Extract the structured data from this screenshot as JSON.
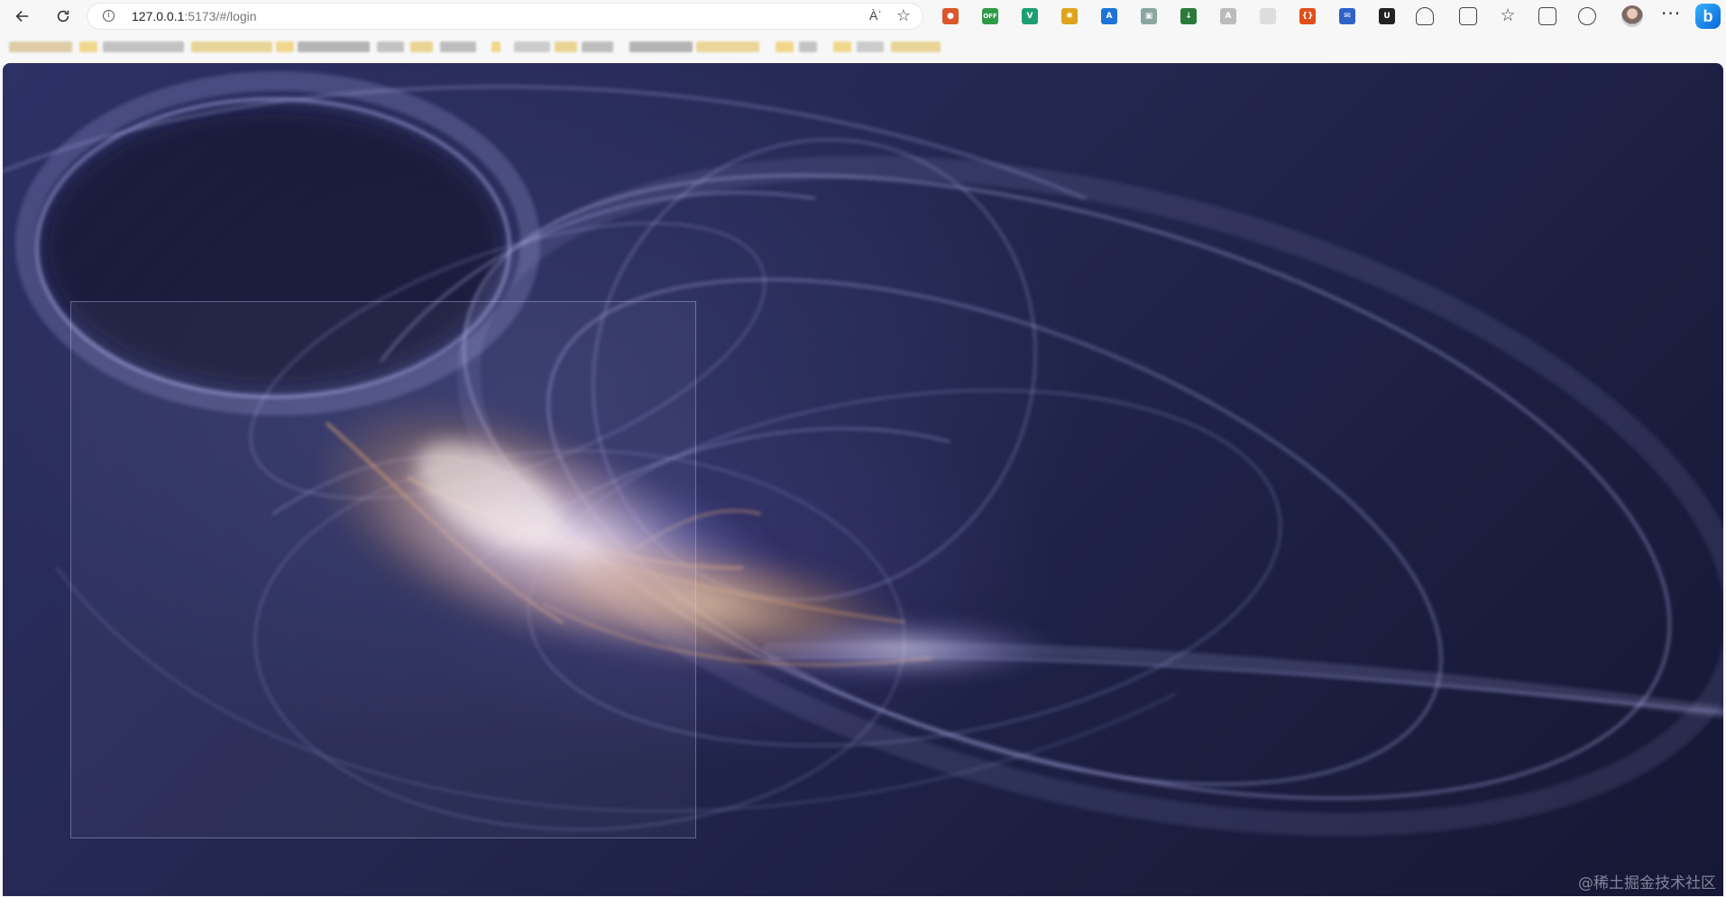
{
  "browser": {
    "url_host": "127.0.0.1",
    "url_path": ":5173/#/login",
    "read_aloud_label": "Àʾ",
    "extensions": [
      {
        "name": "tampermonkey-icon",
        "color": "#d9572b",
        "glyph": "●"
      },
      {
        "name": "off-badge-icon",
        "color": "#2f9a48",
        "glyph": "OFF"
      },
      {
        "name": "vue-devtools-icon",
        "color": "#1d9e73",
        "glyph": "V"
      },
      {
        "name": "bee-icon",
        "color": "#e0a31e",
        "glyph": "✱"
      },
      {
        "name": "translate-icon",
        "color": "#1f73d8",
        "glyph": "A"
      },
      {
        "name": "image-icon",
        "color": "#8aa6a0",
        "glyph": "▣"
      },
      {
        "name": "download-icon",
        "color": "#2b7a3a",
        "glyph": "↓"
      },
      {
        "name": "a-icon",
        "color": "#bbbbbb",
        "glyph": "A"
      },
      {
        "name": "blank-ext-icon",
        "color": "#dddddd",
        "glyph": ""
      },
      {
        "name": "dev-ext-icon",
        "color": "#e24e1b",
        "glyph": "{}"
      },
      {
        "name": "mail-icon",
        "color": "#2e62c7",
        "glyph": "✉"
      },
      {
        "name": "u-icon",
        "color": "#222222",
        "glyph": "U"
      }
    ],
    "more_label": "···",
    "bing_label": "b"
  },
  "page": {
    "watermark": "@稀土掘金技术社区"
  }
}
